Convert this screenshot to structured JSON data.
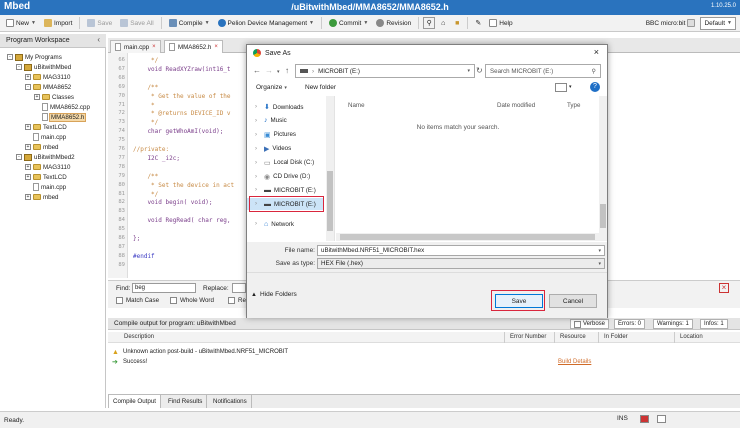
{
  "app": {
    "logo": "Mbed",
    "path": "/uBitwithMbed/MMA8652/MMA8652.h",
    "version": "1.10.25.0"
  },
  "toolbar": {
    "new": "New",
    "import": "Import",
    "save": "Save",
    "save_all": "Save All",
    "compile": "Compile",
    "pelion": "Pelion Device Management",
    "commit": "Commit",
    "revision": "Revision",
    "help": "Help",
    "target": "BBC micro:bit",
    "theme": "Default"
  },
  "workspace": {
    "title": "Program Workspace",
    "tree": [
      {
        "label": "My Programs",
        "level": 0,
        "kind": "root",
        "expand": "-"
      },
      {
        "label": "uBitwithMbed",
        "level": 1,
        "kind": "project",
        "expand": "-"
      },
      {
        "label": "MAG3110",
        "level": 2,
        "kind": "folder",
        "expand": "+"
      },
      {
        "label": "MMA8652",
        "level": 2,
        "kind": "folder",
        "expand": "-"
      },
      {
        "label": "Classes",
        "level": 3,
        "kind": "folder",
        "expand": "+"
      },
      {
        "label": "MMA8652.cpp",
        "level": 3,
        "kind": "file",
        "expand": ""
      },
      {
        "label": "MMA8652.h",
        "level": 3,
        "kind": "file",
        "expand": "",
        "selected": true
      },
      {
        "label": "TextLCD",
        "level": 2,
        "kind": "folder",
        "expand": "+"
      },
      {
        "label": "main.cpp",
        "level": 2,
        "kind": "file",
        "expand": ""
      },
      {
        "label": "mbed",
        "level": 2,
        "kind": "gear",
        "expand": "+"
      },
      {
        "label": "uBitwithMbed2",
        "level": 1,
        "kind": "project",
        "expand": "-"
      },
      {
        "label": "MAG3110",
        "level": 2,
        "kind": "folder",
        "expand": "+"
      },
      {
        "label": "TextLCD",
        "level": 2,
        "kind": "folder",
        "expand": "+"
      },
      {
        "label": "main.cpp",
        "level": 2,
        "kind": "file",
        "expand": ""
      },
      {
        "label": "mbed",
        "level": 2,
        "kind": "gear",
        "expand": "+"
      }
    ]
  },
  "editor": {
    "tabs": [
      {
        "label": "main.cpp"
      },
      {
        "label": "MMA8652.h"
      }
    ],
    "lines": [
      {
        "n": "66",
        "t": "     */",
        "c": "cm"
      },
      {
        "n": "67",
        "t": "    void ReadXYZraw(int16_t",
        "c": ""
      },
      {
        "n": "68",
        "t": "",
        "c": ""
      },
      {
        "n": "69",
        "t": "    /**",
        "c": "cm"
      },
      {
        "n": "70",
        "t": "     * Get the value of the",
        "c": "cm"
      },
      {
        "n": "71",
        "t": "     *",
        "c": "cm"
      },
      {
        "n": "72",
        "t": "     * @returns DEVICE_ID v",
        "c": "cm"
      },
      {
        "n": "73",
        "t": "     */",
        "c": "cm"
      },
      {
        "n": "74",
        "t": "    char getWhoAmI(void);",
        "c": ""
      },
      {
        "n": "75",
        "t": "",
        "c": ""
      },
      {
        "n": "76",
        "t": "//private:",
        "c": "cm"
      },
      {
        "n": "77",
        "t": "    I2C _i2c;",
        "c": ""
      },
      {
        "n": "78",
        "t": "",
        "c": ""
      },
      {
        "n": "79",
        "t": "    /**",
        "c": "cm"
      },
      {
        "n": "80",
        "t": "     * Set the device in act",
        "c": "cm"
      },
      {
        "n": "81",
        "t": "     */",
        "c": "cm"
      },
      {
        "n": "82",
        "t": "    void begin( void);",
        "c": ""
      },
      {
        "n": "83",
        "t": "",
        "c": ""
      },
      {
        "n": "84",
        "t": "    void RegRead( char reg,",
        "c": ""
      },
      {
        "n": "85",
        "t": "",
        "c": ""
      },
      {
        "n": "86",
        "t": "};",
        "c": ""
      },
      {
        "n": "87",
        "t": "",
        "c": ""
      },
      {
        "n": "88",
        "t": "#endif",
        "c": "kw"
      },
      {
        "n": "89",
        "t": "",
        "c": ""
      }
    ]
  },
  "find": {
    "find_label": "Find:",
    "find_value": "beg",
    "replace_label": "Replace:",
    "match_case": "Match Case",
    "whole_word": "Whole Word",
    "regex": "Re"
  },
  "output": {
    "title": "Compile output for program: uBitwithMbed",
    "verbose": "Verbose",
    "errors": "Errors: 0",
    "warnings": "Warnings: 1",
    "infos": "Infos: 1",
    "columns": [
      "Description",
      "Error Number",
      "Resource",
      "In Folder",
      "Location"
    ],
    "rows": [
      {
        "desc": "Unknown action post-build - uBitwithMbed.NRF51_MICROBIT",
        "link": "",
        "kind": "warn"
      },
      {
        "desc": "Success!",
        "link": "Build Details",
        "kind": "ok"
      }
    ],
    "tabs": [
      "Compile Output",
      "Find Results",
      "Notifications"
    ]
  },
  "statusbar": {
    "text": "Ready.",
    "ins": "INS"
  },
  "dialog": {
    "title": "Save As",
    "address": "MICROBIT (E:)",
    "search_placeholder": "Search MICROBIT (E:)",
    "organize": "Organize",
    "new_folder": "New folder",
    "nav_items": [
      {
        "label": "Downloads",
        "icon": "download-icon"
      },
      {
        "label": "Music",
        "icon": "music-icon"
      },
      {
        "label": "Pictures",
        "icon": "pictures-icon"
      },
      {
        "label": "Videos",
        "icon": "videos-icon"
      },
      {
        "label": "Local Disk (C:)",
        "icon": "disk-icon"
      },
      {
        "label": "CD Drive (D:)",
        "icon": "cd-icon"
      },
      {
        "label": "MICROBIT (E:)",
        "icon": "usb-drive-icon"
      },
      {
        "label": "MICROBIT (E:)",
        "icon": "usb-drive-icon",
        "selected": true
      },
      {
        "label": "Network",
        "icon": "network-icon"
      }
    ],
    "columns": [
      "Name",
      "Date modified",
      "Type"
    ],
    "empty_text": "No items match your search.",
    "file_name_label": "File name:",
    "file_name_value": "uBitwithMbed.NRF51_MICROBIT.hex",
    "save_type_label": "Save as type:",
    "save_type_value": "HEX File (.hex)",
    "hide_folders": "Hide Folders",
    "save": "Save",
    "cancel": "Cancel"
  },
  "colors": {
    "brand": "#2a73be",
    "highlight": "#d9263d",
    "link": "#d06b28"
  }
}
